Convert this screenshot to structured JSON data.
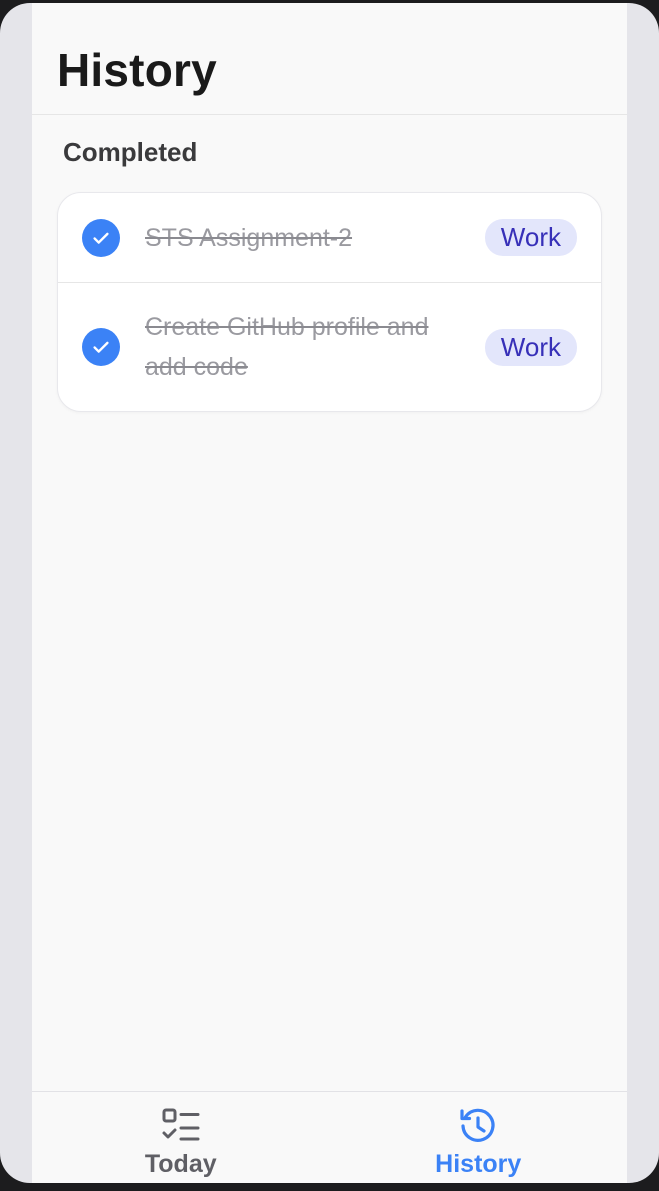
{
  "header": {
    "title": "History"
  },
  "section": {
    "title": "Completed"
  },
  "tasks": [
    {
      "title": "STS Assignment-2",
      "tag": "Work",
      "completed": true
    },
    {
      "title": "Create GitHub profile and add code",
      "tag": "Work",
      "completed": true
    }
  ],
  "tab_bar": {
    "tabs": [
      {
        "label": "Today",
        "icon": "checklist-icon",
        "active": false
      },
      {
        "label": "History",
        "icon": "history-clock-icon",
        "active": true
      }
    ]
  },
  "colors": {
    "accent": "#3b82f6",
    "tag_bg": "#e3e6fb",
    "tag_text": "#3730b8"
  }
}
